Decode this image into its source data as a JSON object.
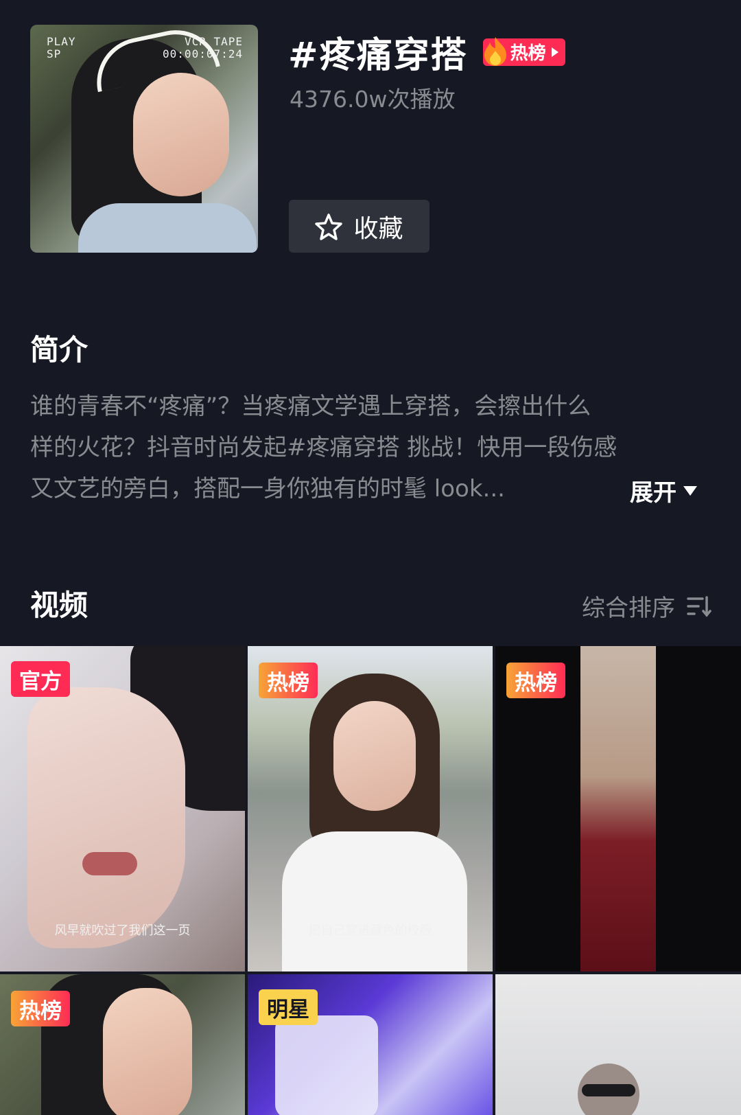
{
  "cover": {
    "vcr_left": [
      "PLAY",
      "SP"
    ],
    "vcr_right": [
      "VCR TAPE",
      "00:00:07:24"
    ]
  },
  "topic": {
    "title": "#疼痛穿搭",
    "badge": "热榜",
    "plays": "4376.0w次播放",
    "collect_label": "收藏"
  },
  "intro": {
    "heading": "简介",
    "lines": [
      "谁的青春不“疼痛”？当疼痛文学遇上穿搭，会擦出什么",
      "样的火花？抖音时尚发起#疼痛穿搭 挑战！快用一段伤感",
      "又文艺的旁白，搭配一身你独有的时髦 look..."
    ],
    "expand_label": "展开"
  },
  "videos": {
    "heading": "视频",
    "sort_label": "综合排序",
    "items": [
      {
        "tag": "官方",
        "subtitle": "风早就吹过了我们这一页"
      },
      {
        "tag": "热榜",
        "subtitle": "把自己穿进藏色的校服"
      },
      {
        "tag": "热榜",
        "subtitle": ""
      },
      {
        "tag": "热榜",
        "subtitle": ""
      },
      {
        "tag": "明星",
        "subtitle": ""
      },
      {
        "tag": "",
        "subtitle": ""
      }
    ]
  }
}
